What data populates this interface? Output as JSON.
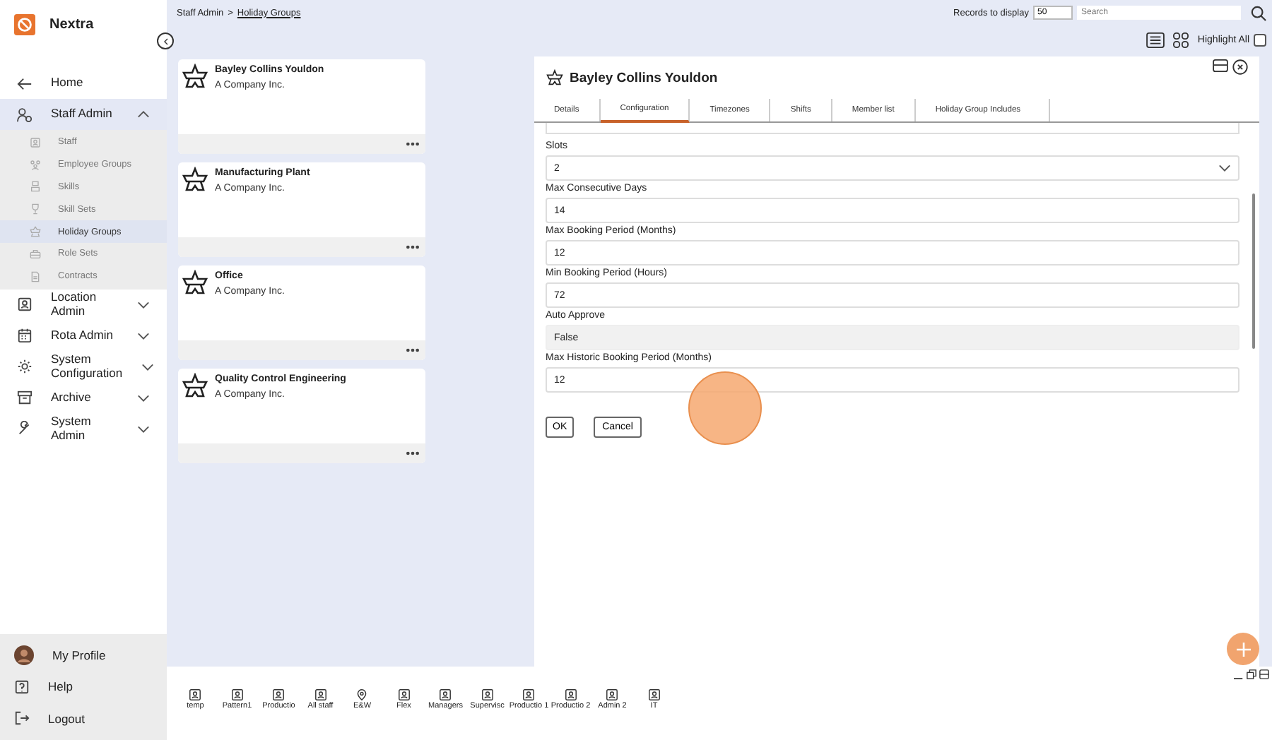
{
  "app": {
    "name": "Nextra"
  },
  "sidebar": {
    "items": [
      {
        "label": "Home",
        "kind": "back"
      },
      {
        "label": "Staff Admin",
        "kind": "users",
        "expanded": true,
        "children": [
          {
            "label": "Staff",
            "kind": "badge",
            "selected": false
          },
          {
            "label": "Employee Groups",
            "kind": "group",
            "selected": false
          },
          {
            "label": "Skills",
            "kind": "skill",
            "selected": false
          },
          {
            "label": "Skill Sets",
            "kind": "trophy",
            "selected": false
          },
          {
            "label": "Holiday Groups",
            "kind": "plane",
            "selected": true
          },
          {
            "label": "Role Sets",
            "kind": "case",
            "selected": false
          },
          {
            "label": "Contracts",
            "kind": "doc",
            "selected": false
          }
        ]
      },
      {
        "label": "Location Admin",
        "kind": "badge",
        "expanded": false
      },
      {
        "label": "Rota Admin",
        "kind": "calendar",
        "expanded": false
      },
      {
        "label": "System Configuration",
        "kind": "gear",
        "expanded": false
      },
      {
        "label": "Archive",
        "kind": "archive",
        "expanded": false
      },
      {
        "label": "System Admin",
        "kind": "wrench",
        "expanded": false
      }
    ],
    "footer": [
      {
        "label": "My Profile",
        "kind": "avatar"
      },
      {
        "label": "Help",
        "kind": "help"
      },
      {
        "label": "Logout",
        "kind": "logout"
      }
    ]
  },
  "breadcrumb": {
    "parent": "Staff Admin",
    "separator": ">",
    "current": "Holiday Groups"
  },
  "toolbar": {
    "records_label": "Records to display",
    "records_value": "50",
    "search_placeholder": "Search",
    "highlight_label": "Highlight All",
    "highlight_checked": false
  },
  "cards": [
    {
      "title": "Bayley Collins Youldon",
      "subtitle": "A Company Inc."
    },
    {
      "title": "Manufacturing Plant",
      "subtitle": "A Company Inc."
    },
    {
      "title": "Office",
      "subtitle": "A Company Inc."
    },
    {
      "title": "Quality Control Engineering",
      "subtitle": "A Company Inc."
    }
  ],
  "dialog": {
    "title": "Bayley Collins Youldon",
    "tabs": [
      {
        "label": "Details",
        "selected": false
      },
      {
        "label": "Configuration",
        "selected": true
      },
      {
        "label": "Timezones",
        "selected": false
      },
      {
        "label": "Shifts",
        "selected": false
      },
      {
        "label": "Member list",
        "selected": false
      },
      {
        "label": "Holiday Group Includes",
        "selected": false
      }
    ],
    "fields": [
      {
        "label": "Slots",
        "value": "2",
        "kind": "select"
      },
      {
        "label": "Max Consecutive Days",
        "value": "14",
        "kind": "input"
      },
      {
        "label": "Max Booking Period (Months)",
        "value": "12",
        "kind": "input"
      },
      {
        "label": "Min Booking Period (Hours)",
        "value": "72",
        "kind": "input"
      },
      {
        "label": "Auto Approve",
        "value": "False",
        "kind": "readonly"
      },
      {
        "label": "Max Historic Booking Period (Months)",
        "value": "12",
        "kind": "input"
      }
    ],
    "buttons": [
      "OK",
      "Cancel"
    ]
  },
  "taskbar": [
    {
      "label": "temp",
      "kind": "person"
    },
    {
      "label": "Pattern1",
      "kind": "person"
    },
    {
      "label": "Productio",
      "kind": "person"
    },
    {
      "label": "All staff",
      "kind": "person"
    },
    {
      "label": "E&W",
      "kind": "pin"
    },
    {
      "label": "Flex",
      "kind": "person"
    },
    {
      "label": "Managers",
      "kind": "person"
    },
    {
      "label": "Supervisc",
      "kind": "person"
    },
    {
      "label": "Productio 1",
      "kind": "person"
    },
    {
      "label": "Productio 2",
      "kind": "person"
    },
    {
      "label": "Admin 2",
      "kind": "person"
    },
    {
      "label": "IT",
      "kind": "person"
    }
  ]
}
